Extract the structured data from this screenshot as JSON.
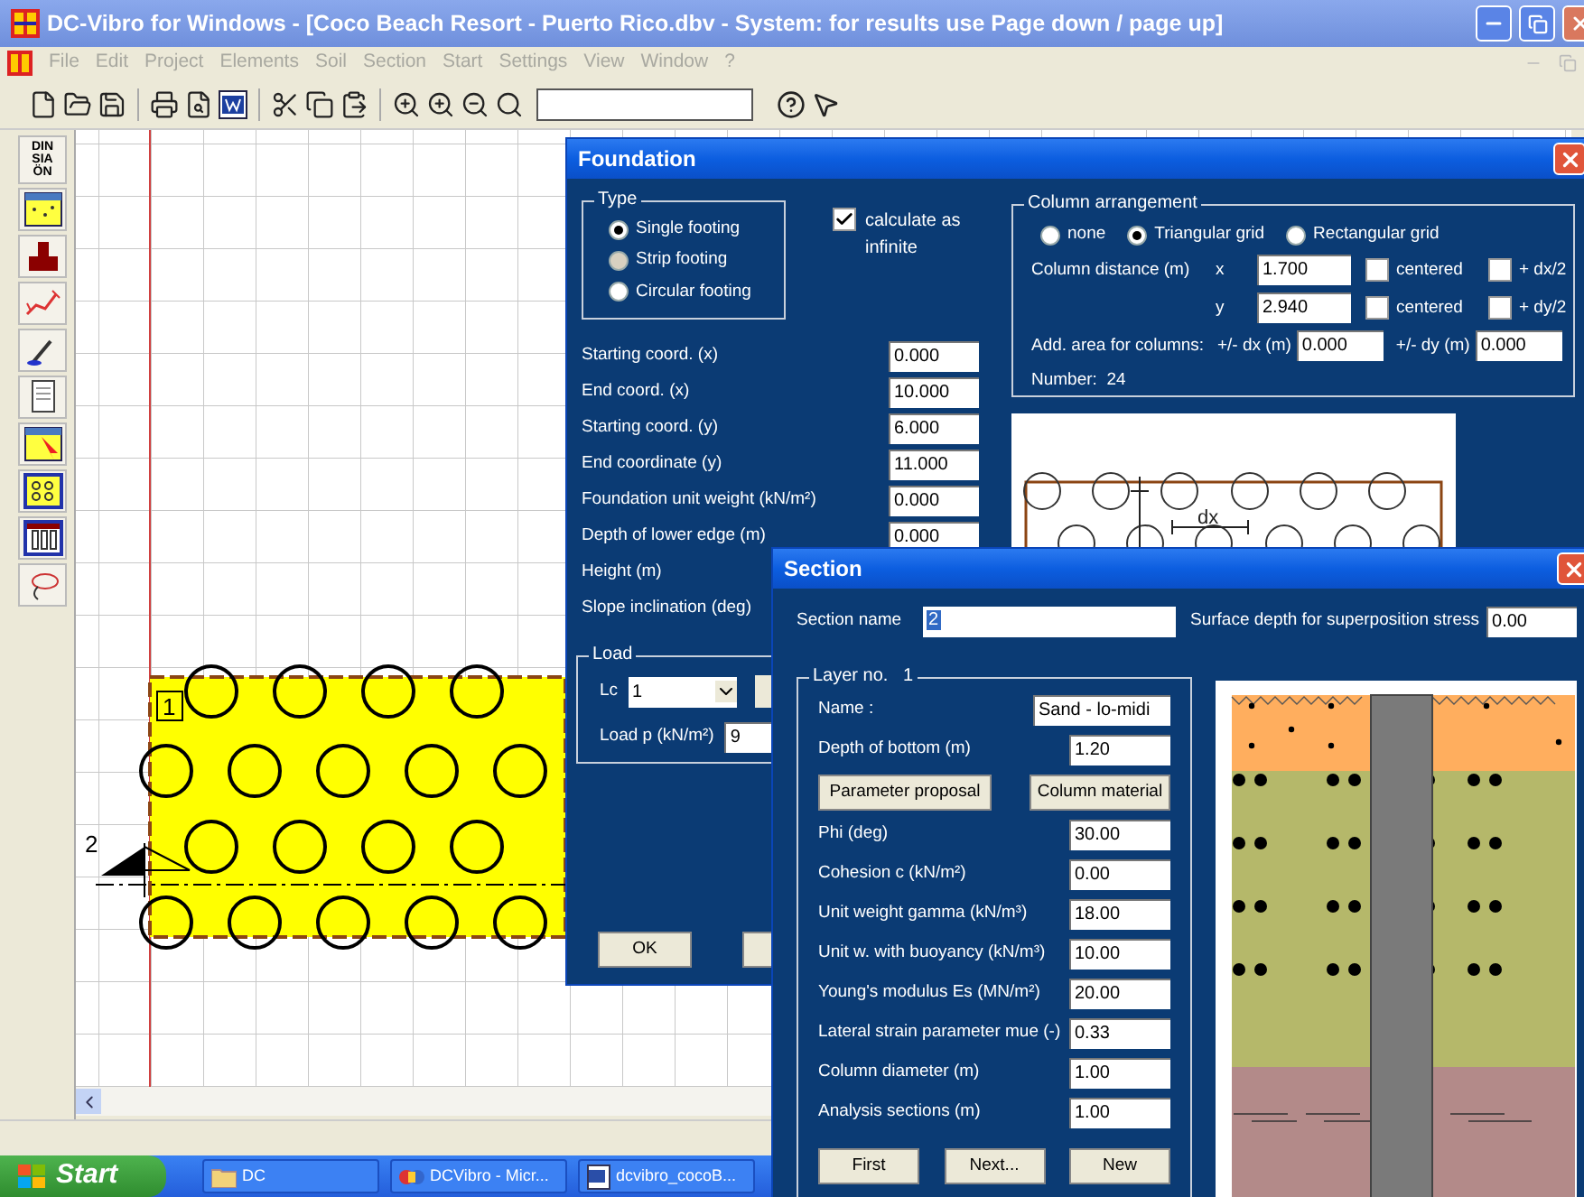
{
  "window": {
    "title": "DC-Vibro for Windows - [Coco Beach Resort - Puerto Rico.dbv - System: for results use Page down / page up]"
  },
  "menu": [
    {
      "label": "File",
      "disabled": true
    },
    {
      "label": "Edit",
      "disabled": true
    },
    {
      "label": "Project",
      "disabled": true
    },
    {
      "label": "Elements",
      "disabled": true
    },
    {
      "label": "Soil",
      "disabled": true
    },
    {
      "label": "Section",
      "disabled": true
    },
    {
      "label": "Start",
      "disabled": true
    },
    {
      "label": "Settings",
      "disabled": true
    },
    {
      "label": "View",
      "disabled": true
    },
    {
      "label": "Window",
      "disabled": true
    },
    {
      "label": "?",
      "disabled": true
    }
  ],
  "left_toolbar": {
    "norm_button": [
      "DIN",
      "SIA",
      "ÖN"
    ]
  },
  "canvas": {
    "footing_label": "1",
    "section_label": "2"
  },
  "foundation_dialog": {
    "title": "Foundation",
    "type_group": {
      "title": "Type",
      "options": [
        {
          "label": "Single footing",
          "selected": true,
          "disabled": false
        },
        {
          "label": "Strip footing",
          "selected": false,
          "disabled": true
        },
        {
          "label": "Circular footing",
          "selected": false,
          "disabled": false
        }
      ]
    },
    "infinite": {
      "label": "calculate as infinite",
      "checked": true
    },
    "fields": [
      {
        "label": "Starting coord. (x)",
        "value": "0.000"
      },
      {
        "label": "End coord. (x)",
        "value": "10.000"
      },
      {
        "label": "Starting coord. (y)",
        "value": "6.000"
      },
      {
        "label": "End coordinate (y)",
        "value": "11.000"
      },
      {
        "label": "Foundation unit weight (kN/m²)",
        "value": "0.000"
      },
      {
        "label": "Depth of lower edge (m)",
        "value": "0.000"
      },
      {
        "label": "Height (m)"
      },
      {
        "label": "Slope inclination (deg)"
      }
    ],
    "load_group": {
      "title": "Load",
      "lc_label": "Lc",
      "lc_value": "1",
      "load_label": "Load p (kN/m²)",
      "load_value": "9"
    },
    "column_group": {
      "title": "Column arrangement",
      "options": [
        {
          "label": "none",
          "selected": false
        },
        {
          "label": "Triangular grid",
          "selected": true
        },
        {
          "label": "Rectangular grid",
          "selected": false
        }
      ],
      "distance_label": "Column distance (m)",
      "x_label": "x",
      "x_value": "1.700",
      "y_label": "y",
      "y_value": "2.940",
      "checks": [
        {
          "label": "centered",
          "checked": false
        },
        {
          "label": "+ dx/2",
          "checked": false
        },
        {
          "label": "centered",
          "checked": false
        },
        {
          "label": "+ dy/2",
          "checked": false
        }
      ],
      "add_area_label": "Add. area for columns:",
      "dx_label": "+/- dx (m)",
      "dx_value": "0.000",
      "dy_label": "+/- dy (m)",
      "dy_value": "0.000",
      "number": "Number:  24"
    },
    "preview": {
      "dimension_label": "dx"
    },
    "ok_button": "OK"
  },
  "section_dialog": {
    "title": "Section",
    "name_label": "Section name",
    "name_value": "2",
    "surface_label": "Surface depth for superposition stress",
    "surface_value": "0.00",
    "layer_title": "Layer no.   1",
    "rows": [
      {
        "kind": "wide_field",
        "label": "Name   :",
        "value": "Sand - lo-midi"
      },
      {
        "kind": "field",
        "label": "Depth of bottom (m)",
        "value": "1.20"
      },
      {
        "kind": "buttons",
        "buttons": [
          "Parameter proposal",
          "Column material"
        ]
      },
      {
        "kind": "field",
        "label": "Phi (deg)",
        "value": "30.00"
      },
      {
        "kind": "field",
        "label": "Cohesion c (kN/m²)",
        "value": "0.00"
      },
      {
        "kind": "field",
        "label": "Unit weight gamma (kN/m³)",
        "value": "18.00"
      },
      {
        "kind": "field",
        "label": "Unit w. with buoyancy (kN/m³)",
        "value": "10.00"
      },
      {
        "kind": "field",
        "label": "Young's modulus Es (MN/m²)",
        "value": "20.00"
      },
      {
        "kind": "field",
        "label": "Lateral strain parameter mue (-)",
        "value": "0.33"
      },
      {
        "kind": "field",
        "label": "Column diameter (m)",
        "value": "1.00"
      },
      {
        "kind": "field",
        "label": "Analysis sections (m)",
        "value": "1.00"
      }
    ],
    "nav_buttons": [
      "First",
      "Next...",
      "New"
    ]
  },
  "taskbar": {
    "start": "Start",
    "tasks": [
      {
        "label": "DC",
        "kind": "folder"
      },
      {
        "label": "DCVibro - Micr...",
        "kind": "app"
      },
      {
        "label": "dcvibro_cocoB...",
        "kind": "document"
      }
    ]
  }
}
